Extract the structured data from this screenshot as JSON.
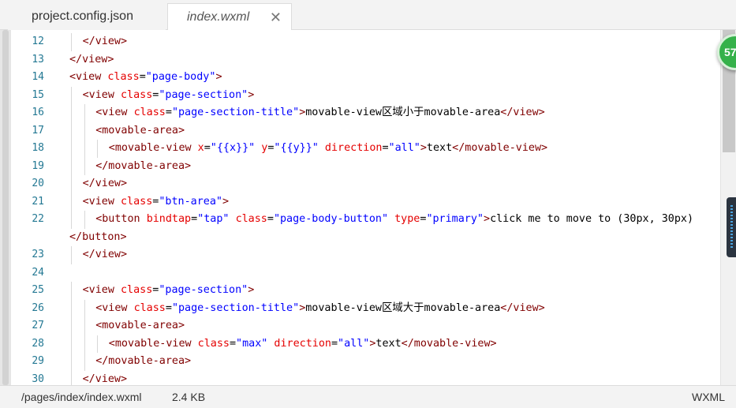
{
  "tabs": [
    {
      "label": "project.config.json",
      "active": false
    },
    {
      "label": "index.wxml",
      "active": true,
      "close_icon": "close-icon"
    }
  ],
  "badge": {
    "text": "57",
    "color": "#35b14a"
  },
  "editor": {
    "lines": [
      {
        "no": "12",
        "tokens": [
          [
            "tg",
            "</view>"
          ]
        ]
      },
      {
        "no": "13",
        "tokens": [
          [
            "tg",
            "</view>"
          ]
        ]
      },
      {
        "no": "14",
        "tokens": [
          [
            "tg",
            "<view "
          ],
          [
            "at",
            "class"
          ],
          [
            "tx",
            "="
          ],
          [
            "av",
            "\"page-body\""
          ],
          [
            "tg",
            ">"
          ]
        ]
      },
      {
        "no": "15",
        "tokens": [
          [
            "tg",
            "<view "
          ],
          [
            "at",
            "class"
          ],
          [
            "tx",
            "="
          ],
          [
            "av",
            "\"page-section\""
          ],
          [
            "tg",
            ">"
          ]
        ]
      },
      {
        "no": "16",
        "tokens": [
          [
            "tg",
            "<view "
          ],
          [
            "at",
            "class"
          ],
          [
            "tx",
            "="
          ],
          [
            "av",
            "\"page-section-title\""
          ],
          [
            "tg",
            ">"
          ],
          [
            "tx",
            "movable-view区域小于movable-area"
          ],
          [
            "tg",
            "</view>"
          ]
        ]
      },
      {
        "no": "17",
        "tokens": [
          [
            "tg",
            "<movable-area>"
          ]
        ]
      },
      {
        "no": "18",
        "tokens": [
          [
            "tg",
            "<movable-view "
          ],
          [
            "at",
            "x"
          ],
          [
            "tx",
            "="
          ],
          [
            "av",
            "\"{{x}}\""
          ],
          [
            "tx",
            " "
          ],
          [
            "at",
            "y"
          ],
          [
            "tx",
            "="
          ],
          [
            "av",
            "\"{{y}}\""
          ],
          [
            "tx",
            " "
          ],
          [
            "at",
            "direction"
          ],
          [
            "tx",
            "="
          ],
          [
            "av",
            "\"all\""
          ],
          [
            "tg",
            ">"
          ],
          [
            "tx",
            "text"
          ],
          [
            "tg",
            "</movable-view>"
          ]
        ]
      },
      {
        "no": "19",
        "tokens": [
          [
            "tg",
            "</movable-area>"
          ]
        ]
      },
      {
        "no": "20",
        "tokens": [
          [
            "tg",
            "</view>"
          ]
        ]
      },
      {
        "no": "21",
        "tokens": [
          [
            "tg",
            "<view "
          ],
          [
            "at",
            "class"
          ],
          [
            "tx",
            "="
          ],
          [
            "av",
            "\"btn-area\""
          ],
          [
            "tg",
            ">"
          ]
        ]
      },
      {
        "no": "22",
        "tokens": [
          [
            "tg",
            "<button "
          ],
          [
            "at",
            "bindtap"
          ],
          [
            "tx",
            "="
          ],
          [
            "av",
            "\"tap\""
          ],
          [
            "tx",
            " "
          ],
          [
            "at",
            "class"
          ],
          [
            "tx",
            "="
          ],
          [
            "av",
            "\"page-body-button\""
          ],
          [
            "tx",
            " "
          ],
          [
            "at",
            "type"
          ],
          [
            "tx",
            "="
          ],
          [
            "av",
            "\"primary\""
          ],
          [
            "tg",
            ">"
          ],
          [
            "tx",
            "click me to move to (30px, 30px)"
          ]
        ]
      },
      {
        "no": "",
        "tokens": [
          [
            "tg",
            "</button>"
          ]
        ]
      },
      {
        "no": "23",
        "tokens": [
          [
            "tg",
            "</view>"
          ]
        ]
      },
      {
        "no": "24",
        "tokens": []
      },
      {
        "no": "25",
        "tokens": [
          [
            "tg",
            "<view "
          ],
          [
            "at",
            "class"
          ],
          [
            "tx",
            "="
          ],
          [
            "av",
            "\"page-section\""
          ],
          [
            "tg",
            ">"
          ]
        ]
      },
      {
        "no": "26",
        "tokens": [
          [
            "tg",
            "<view "
          ],
          [
            "at",
            "class"
          ],
          [
            "tx",
            "="
          ],
          [
            "av",
            "\"page-section-title\""
          ],
          [
            "tg",
            ">"
          ],
          [
            "tx",
            "movable-view区域大于movable-area"
          ],
          [
            "tg",
            "</view>"
          ]
        ]
      },
      {
        "no": "27",
        "tokens": [
          [
            "tg",
            "<movable-area>"
          ]
        ]
      },
      {
        "no": "28",
        "tokens": [
          [
            "tg",
            "<movable-view "
          ],
          [
            "at",
            "class"
          ],
          [
            "tx",
            "="
          ],
          [
            "av",
            "\"max\""
          ],
          [
            "tx",
            " "
          ],
          [
            "at",
            "direction"
          ],
          [
            "tx",
            "="
          ],
          [
            "av",
            "\"all\""
          ],
          [
            "tg",
            ">"
          ],
          [
            "tx",
            "text"
          ],
          [
            "tg",
            "</movable-view>"
          ]
        ]
      },
      {
        "no": "29",
        "tokens": [
          [
            "tg",
            "</movable-area>"
          ]
        ]
      },
      {
        "no": "30",
        "tokens": [
          [
            "tg",
            "</view>"
          ]
        ]
      }
    ]
  },
  "status": {
    "path": "/pages/index/index.wxml",
    "size": "2.4 KB",
    "language": "WXML"
  },
  "colors": {
    "tag": "#800000",
    "attr": "#e50000",
    "value": "#0000ff",
    "line_number": "#237893"
  }
}
